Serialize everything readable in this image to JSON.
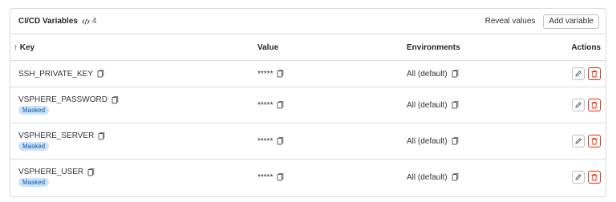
{
  "header": {
    "title": "CI/CD Variables",
    "count": "4",
    "reveal_label": "Reveal values",
    "add_label": "Add variable"
  },
  "columns": {
    "key": "↑ Key",
    "value": "Value",
    "environments": "Environments",
    "actions": "Actions"
  },
  "rows": [
    {
      "key": "SSH_PRIVATE_KEY",
      "masked": "",
      "value": "*****",
      "env": "All (default)"
    },
    {
      "key": "VSPHERE_PASSWORD",
      "masked": "Masked",
      "value": "*****",
      "env": "All (default)"
    },
    {
      "key": "VSPHERE_SERVER",
      "masked": "Masked",
      "value": "*****",
      "env": "All (default)"
    },
    {
      "key": "VSPHERE_USER",
      "masked": "Masked",
      "value": "*****",
      "env": "All (default)"
    }
  ],
  "colors": {
    "delete": "#dd2b0e",
    "badge_bg": "#cbe2f9",
    "badge_text": "#0b5cad"
  }
}
